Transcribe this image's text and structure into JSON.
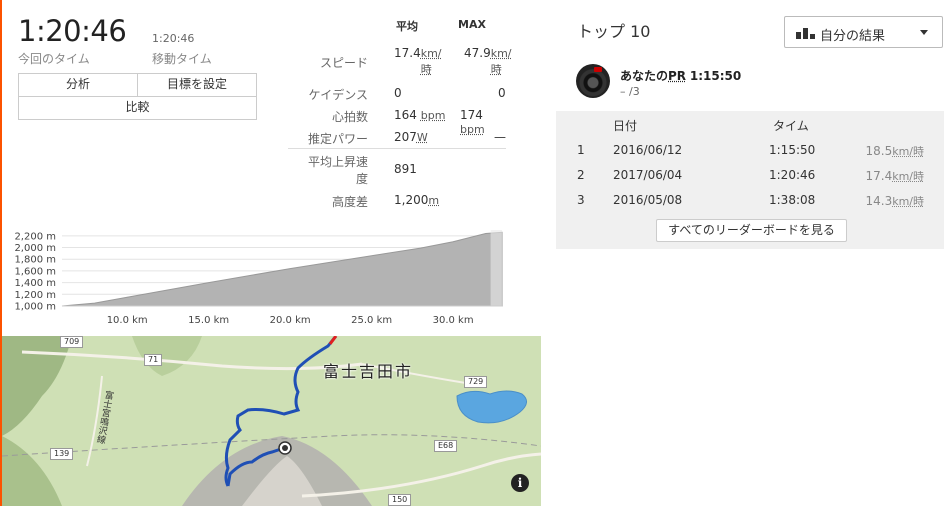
{
  "summary": {
    "elapsed_time": "1:20:46",
    "elapsed_label": "今回のタイム",
    "moving_time": "1:20:46",
    "moving_label": "移動タイム"
  },
  "actions": {
    "analysis": "分析",
    "set_goal": "目標を設定",
    "compare": "比較"
  },
  "stats": {
    "avg_header": "平均",
    "max_header": "MAX",
    "rows": [
      {
        "label": "スピード",
        "avg": "17.4",
        "avg_unit": "km/時",
        "max": "47.9",
        "max_unit": "km/時"
      },
      {
        "label": "ケイデンス",
        "avg": "0",
        "max": "0"
      },
      {
        "label": "心拍数",
        "avg": "164",
        "avg_unit": "bpm",
        "max": "174",
        "max_unit": "bpm"
      },
      {
        "label": "推定パワー",
        "avg": "207",
        "avg_unit": "W",
        "max": "—"
      },
      {
        "label": "平均上昇速度",
        "avg": "891"
      },
      {
        "label": "高度差",
        "avg": "1,200",
        "avg_unit": "m"
      }
    ]
  },
  "chart_data": {
    "type": "area",
    "xlabel": "",
    "ylabel": "",
    "x_ticks": [
      "10.0 km",
      "15.0 km",
      "20.0 km",
      "25.0 km",
      "30.0 km"
    ],
    "y_ticks": [
      "2,200 m",
      "2,000 m",
      "1,800 m",
      "1,600 m",
      "1,400 m",
      "1,200 m",
      "1,000 m"
    ],
    "x": [
      6,
      8,
      10,
      15,
      20,
      25,
      28,
      30,
      32,
      33
    ],
    "y": [
      1000,
      1050,
      1150,
      1400,
      1640,
      1860,
      1990,
      2100,
      2240,
      2260
    ],
    "xlim": [
      6,
      33
    ],
    "ylim": [
      1000,
      2300
    ],
    "grid": true
  },
  "map": {
    "city_label": "富士吉田市",
    "roads": [
      "709",
      "71",
      "729",
      "139",
      "E68",
      "150"
    ],
    "side_road_label": "富士宮鳴沢線",
    "info_label": "i"
  },
  "leaderboard": {
    "title": "トップ 10",
    "filter_label": "自分の結果",
    "pr_text": "あなたの",
    "pr_abbr": "PR",
    "pr_time": "1:15:50",
    "pr_rank": "– /3",
    "col_date": "日付",
    "col_time": "タイム",
    "rows": [
      {
        "rank": "1",
        "date": "2016/06/12",
        "time": "1:15:50",
        "speed": "18.5",
        "unit": "km/時"
      },
      {
        "rank": "2",
        "date": "2017/06/04",
        "time": "1:20:46",
        "speed": "17.4",
        "unit": "km/時"
      },
      {
        "rank": "3",
        "date": "2016/05/08",
        "time": "1:38:08",
        "speed": "14.3",
        "unit": "km/時"
      }
    ],
    "view_all": "すべてのリーダーボードを見る"
  },
  "colors": {
    "accent": "#fc5200",
    "route": "#1f4fb5",
    "route_red": "#e02020",
    "elevation_fill": "#b3b3b3"
  }
}
